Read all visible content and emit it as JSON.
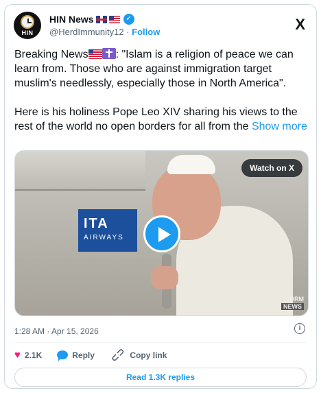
{
  "author": {
    "name": "HIN News",
    "avatar_text": "HIN",
    "handle": "@HerdImmunity12",
    "separator": "·",
    "follow_label": "Follow"
  },
  "icons": {
    "brand": "x-logo-icon",
    "verified": "verified-badge-icon",
    "like": "heart-icon",
    "reply": "reply-icon",
    "copy": "link-icon",
    "info": "info-icon",
    "play": "play-icon"
  },
  "x_logo": "X",
  "tweet": {
    "para1_before": "Breaking News",
    "para1_after": ": \"Islam is a religion of peace we can learn from. Those who are against immigration target muslim's needlessly, especially those in North America\".",
    "para2_text": "Here is his holiness Pope Leo XIV sharing his views to the rest of the world no open borders for all from the ",
    "show_more": "Show more"
  },
  "media": {
    "watch_label": "Watch on X",
    "airline_logo": "ITA",
    "airline_sub": "AIRWAYS",
    "watermark_top": "DRM",
    "watermark_bottom": "NEWS"
  },
  "meta": {
    "timestamp": "1:28 AM · Apr 15, 2026",
    "info_glyph": "i"
  },
  "actions": {
    "likes": "2.1K",
    "reply_label": "Reply",
    "copy_label": "Copy link"
  },
  "replies_button": "Read 1.3K replies",
  "colors": {
    "accent": "#1d9bf0",
    "like": "#f91880",
    "muted_text": "#536471",
    "border": "#cfd9de"
  }
}
